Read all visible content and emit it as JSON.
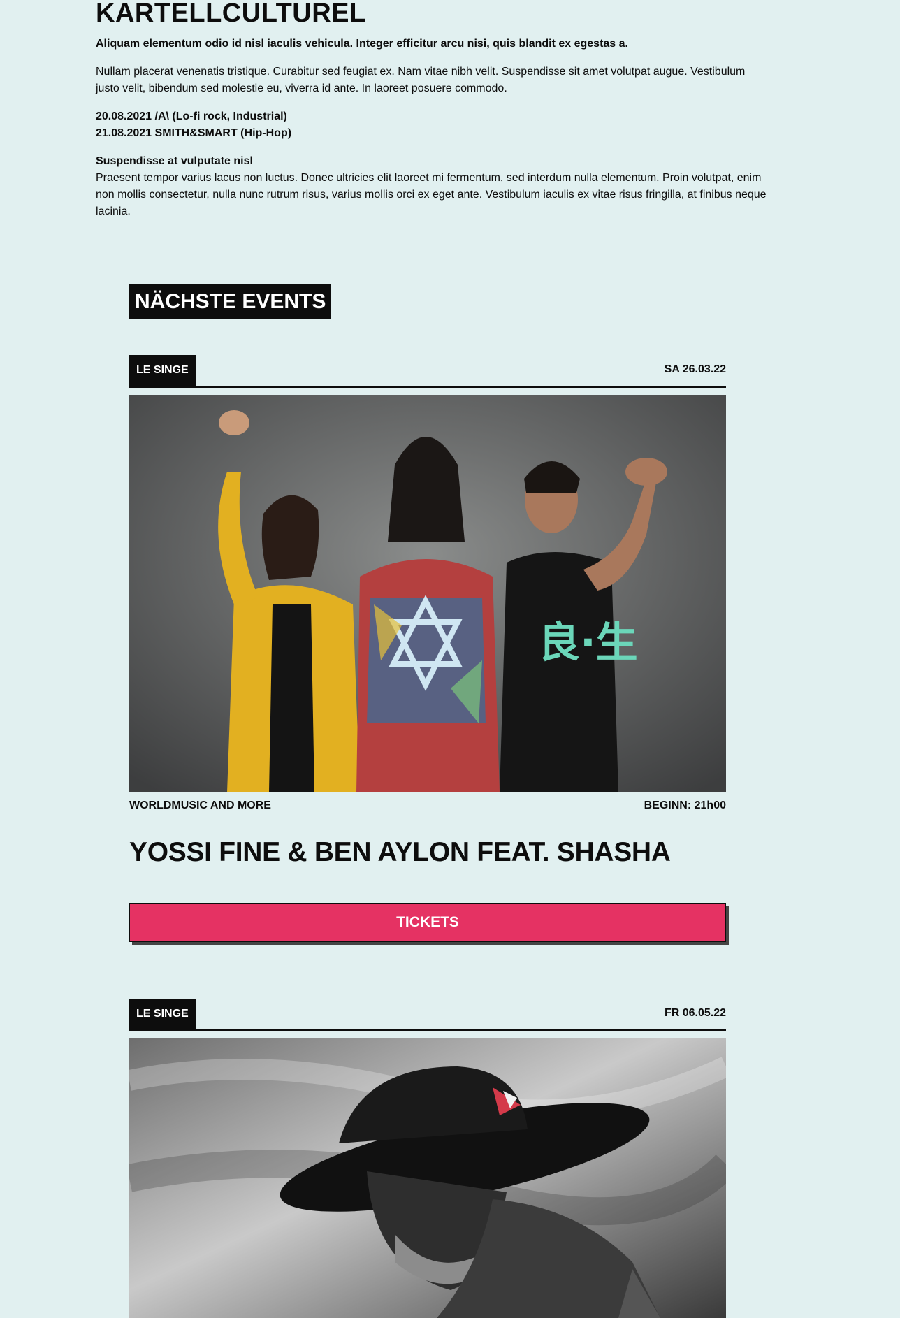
{
  "intro": {
    "title": "KARTELLCULTUREL",
    "lead": "Aliquam elementum odio id nisl iaculis vehicula. Integer efficitur arcu nisi, quis blandit ex egestas a.",
    "paragraph": "Nullam placerat venenatis tristique. Curabitur sed feugiat ex. Nam vitae nibh velit. Suspendisse sit amet volutpat augue. Vestibulum justo velit, bibendum sed molestie eu, viverra id ante. In laoreet posuere commodo.",
    "dates": [
      "20.08.2021 /A\\ (Lo-fi rock, Industrial)",
      "21.08.2021 SMITH&SMART (Hip-Hop)"
    ],
    "subheading": "Suspendisse at vulputate nisl",
    "body": "Praesent tempor varius lacus non luctus. Donec ultricies elit laoreet mi fermentum, sed interdum nulla elementum. Proin volutpat, enim non mollis consectetur, nulla nunc rutrum risus, varius mollis orci ex eget ante. Vestibulum iaculis ex vitae risus fringilla, at finibus neque lacinia."
  },
  "events_section": {
    "heading": "NÄCHSTE EVENTS"
  },
  "events": [
    {
      "venue": "LE SINGE",
      "date": "SA 26.03.22",
      "genre": "WORLDMUSIC AND MORE",
      "start": "BEGINN: 21h00",
      "title": "YOSSI FINE & BEN AYLON FEAT. SHASHA",
      "tickets_label": "TICKETS"
    },
    {
      "venue": "LE SINGE",
      "date": "FR 06.05.22"
    }
  ],
  "colors": {
    "background": "#e1f0f0",
    "ink": "#0d0d0d",
    "tickets": "#e53263"
  }
}
